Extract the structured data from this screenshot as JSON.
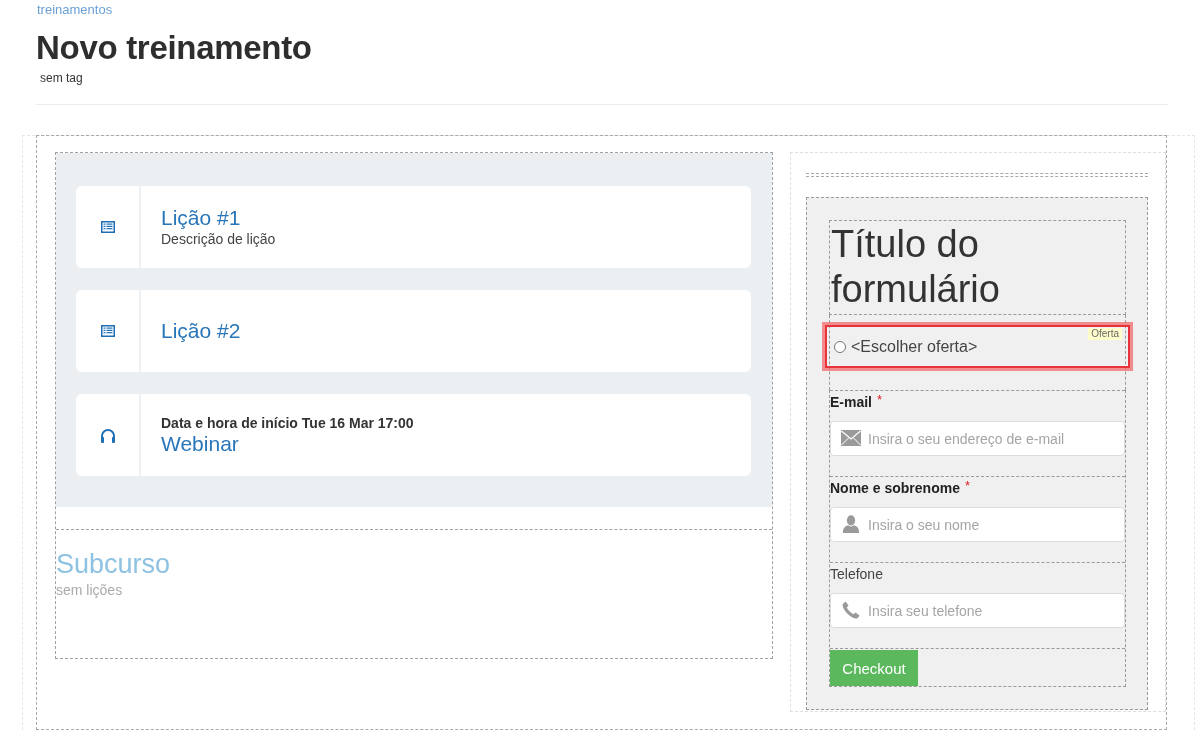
{
  "breadcrumb": {
    "label": "treinamentos"
  },
  "header": {
    "title": "Novo treinamento",
    "tag": "sem tag"
  },
  "lessons": [
    {
      "kind": "lesson",
      "title": "Lição #1",
      "description": "Descrição de lição"
    },
    {
      "kind": "lesson",
      "title": "Lição #2"
    },
    {
      "kind": "webinar",
      "start": "Data e hora de início Tue 16 Mar 17:00",
      "title": "Webinar"
    }
  ],
  "subcourse": {
    "title": "Subcurso",
    "status": "sem lições"
  },
  "form": {
    "title": "Título do formulário",
    "offer": {
      "label": "<Escolher oferta>",
      "tag": "Oferta",
      "selected": false,
      "highlighted": true
    },
    "fields": [
      {
        "kind": "email",
        "label": "E-mail",
        "required": true,
        "marker": "*",
        "placeholder": "Insira o seu endereço de e-mail"
      },
      {
        "kind": "name",
        "label": "Nome e sobrenome",
        "required": true,
        "marker": "*",
        "placeholder": "Insira o seu nome"
      },
      {
        "kind": "phone",
        "label": "Telefone",
        "required": false,
        "placeholder": "Insira seu telefone"
      }
    ],
    "submit": {
      "label": "Checkout"
    }
  }
}
